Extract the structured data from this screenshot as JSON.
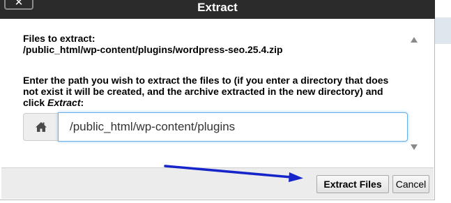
{
  "dialog": {
    "title": "Extract",
    "close_label": "✕"
  },
  "files": {
    "label": "Files to extract:",
    "path": "/public_html/wp-content/plugins/wordpress-seo.25.4.zip"
  },
  "instructions": {
    "text_before": "Enter the path you wish to extract the files to (if you enter a directory that does not exist it will be created, and the archive extracted in the new directory) and click ",
    "emphasis": "Extract",
    "text_after": ":"
  },
  "destination": {
    "icon": "home-icon",
    "value": "/public_html/wp-content/plugins"
  },
  "footer": {
    "primary_label": "Extract Files",
    "cancel_label": "Cancel"
  },
  "annotation": {
    "arrow_color": "#1525c9"
  },
  "colors": {
    "titlebar": "#2b2b2b",
    "input_focus_border": "#66afe9",
    "footer_bg": "#ececec"
  }
}
